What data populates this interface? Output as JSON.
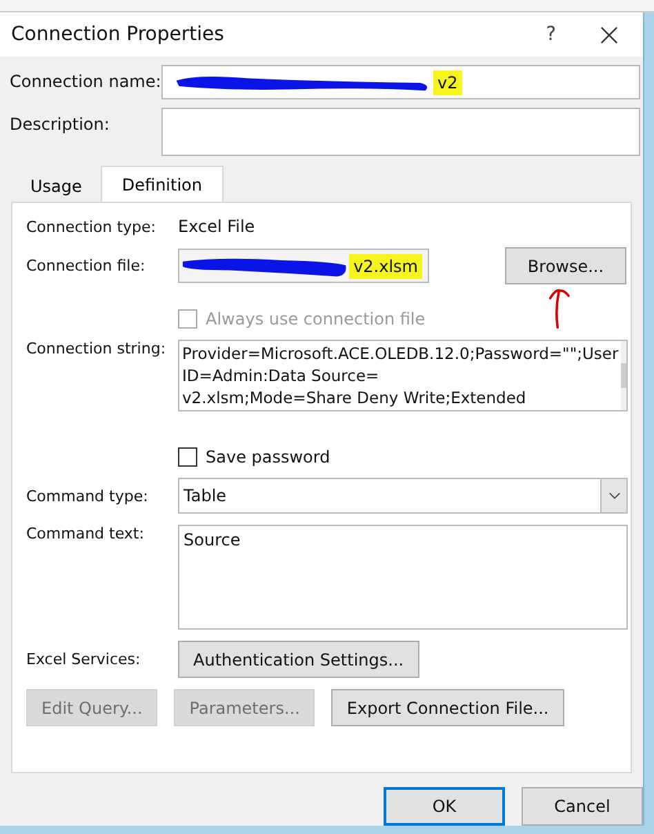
{
  "window": {
    "title": "Connection Properties",
    "help": "?"
  },
  "connection_name": {
    "label": "Connection name:",
    "value": "v2"
  },
  "description": {
    "label": "Description:"
  },
  "tabs": [
    {
      "label": "Usage",
      "selected": false
    },
    {
      "label": "Definition",
      "selected": true
    }
  ],
  "definition": {
    "connection_type": {
      "label": "Connection type:",
      "value": "Excel File"
    },
    "connection_file": {
      "label": "Connection file:",
      "value": "v2.xlsm",
      "button": "Browse..."
    },
    "always_use": {
      "label": "Always use connection file",
      "checked": false,
      "disabled": true
    },
    "connection_string": {
      "label": "Connection string:",
      "lines": [
        "Provider=Microsoft.ACE.OLEDB.12.0;Password=\"\";User",
        "ID=Admin:Data Source=",
        "v2.xlsm;Mode=Share Deny Write;Extended"
      ]
    },
    "save_password": {
      "label": "Save password",
      "checked": false,
      "disabled": false
    },
    "command_type": {
      "label": "Command type:",
      "value": "Table"
    },
    "command_text": {
      "label": "Command text:",
      "value": "Source"
    },
    "excel_services": {
      "label": "Excel Services:",
      "button": "Authentication Settings..."
    },
    "actions": [
      {
        "label": "Edit Query...",
        "disabled": true
      },
      {
        "label": "Parameters...",
        "disabled": true
      },
      {
        "label": "Export Connection File...",
        "disabled": false
      }
    ]
  },
  "buttons": [
    {
      "label": "OK",
      "default": true
    },
    {
      "label": "Cancel",
      "default": false
    }
  ]
}
